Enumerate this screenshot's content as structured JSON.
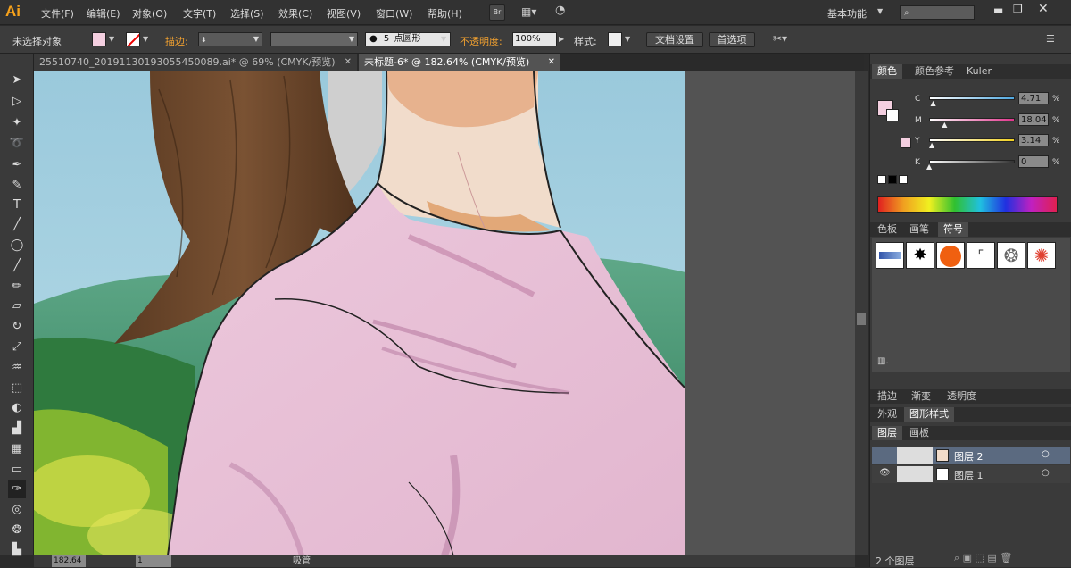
{
  "app": {
    "logo": "Ai"
  },
  "menu": [
    "文件(F)",
    "编辑(E)",
    "对象(O)",
    "文字(T)",
    "选择(S)",
    "效果(C)",
    "视图(V)",
    "窗口(W)",
    "帮助(H)"
  ],
  "menubar_right": {
    "bridge_label": "Br",
    "workspace": "基本功能"
  },
  "control": {
    "selection_label": "未选择对象",
    "stroke_label": "描边:",
    "brush_size": "5",
    "brush_label": "点圆形",
    "opacity_label": "不透明度:",
    "opacity_value": "100%",
    "style_label": "样式:",
    "doc_settings": "文档设置",
    "preferences": "首选项"
  },
  "tabs": [
    {
      "label": "25510740_20191130193055450089.ai* @ 69% (CMYK/预览)",
      "active": false
    },
    {
      "label": "未标题-6* @ 182.64% (CMYK/预览)",
      "active": true
    }
  ],
  "status": {
    "zoom": "182.64",
    "page": "1",
    "tool_name": "吸管"
  },
  "color_panel": {
    "tabs": [
      "颜色",
      "颜色参考",
      "Kuler"
    ],
    "channels": [
      {
        "name": "C",
        "value": "4.71",
        "color": "#4fa8e0",
        "fraction": 0.047
      },
      {
        "name": "M",
        "value": "18.04",
        "color": "#e0358c",
        "fraction": 0.18
      },
      {
        "name": "Y",
        "value": "3.14",
        "color": "#f0d020",
        "fraction": 0.031
      },
      {
        "name": "K",
        "value": "0",
        "color": "#333333",
        "fraction": 0
      }
    ],
    "unit": "%",
    "fill_color": "#f4cfe0"
  },
  "swatch_panel": {
    "tabs": [
      "色板",
      "画笔",
      "符号"
    ]
  },
  "stroke_panel": {
    "tabs": [
      "描边",
      "渐变",
      "透明度"
    ]
  },
  "appearance_panel": {
    "tabs": [
      "外观",
      "图形样式"
    ]
  },
  "layers_panel": {
    "tabs": [
      "图层",
      "画板"
    ],
    "layers": [
      {
        "name": "图层 2",
        "selected": true
      },
      {
        "name": "图层 1",
        "selected": false
      }
    ],
    "count": "2 个图层"
  }
}
